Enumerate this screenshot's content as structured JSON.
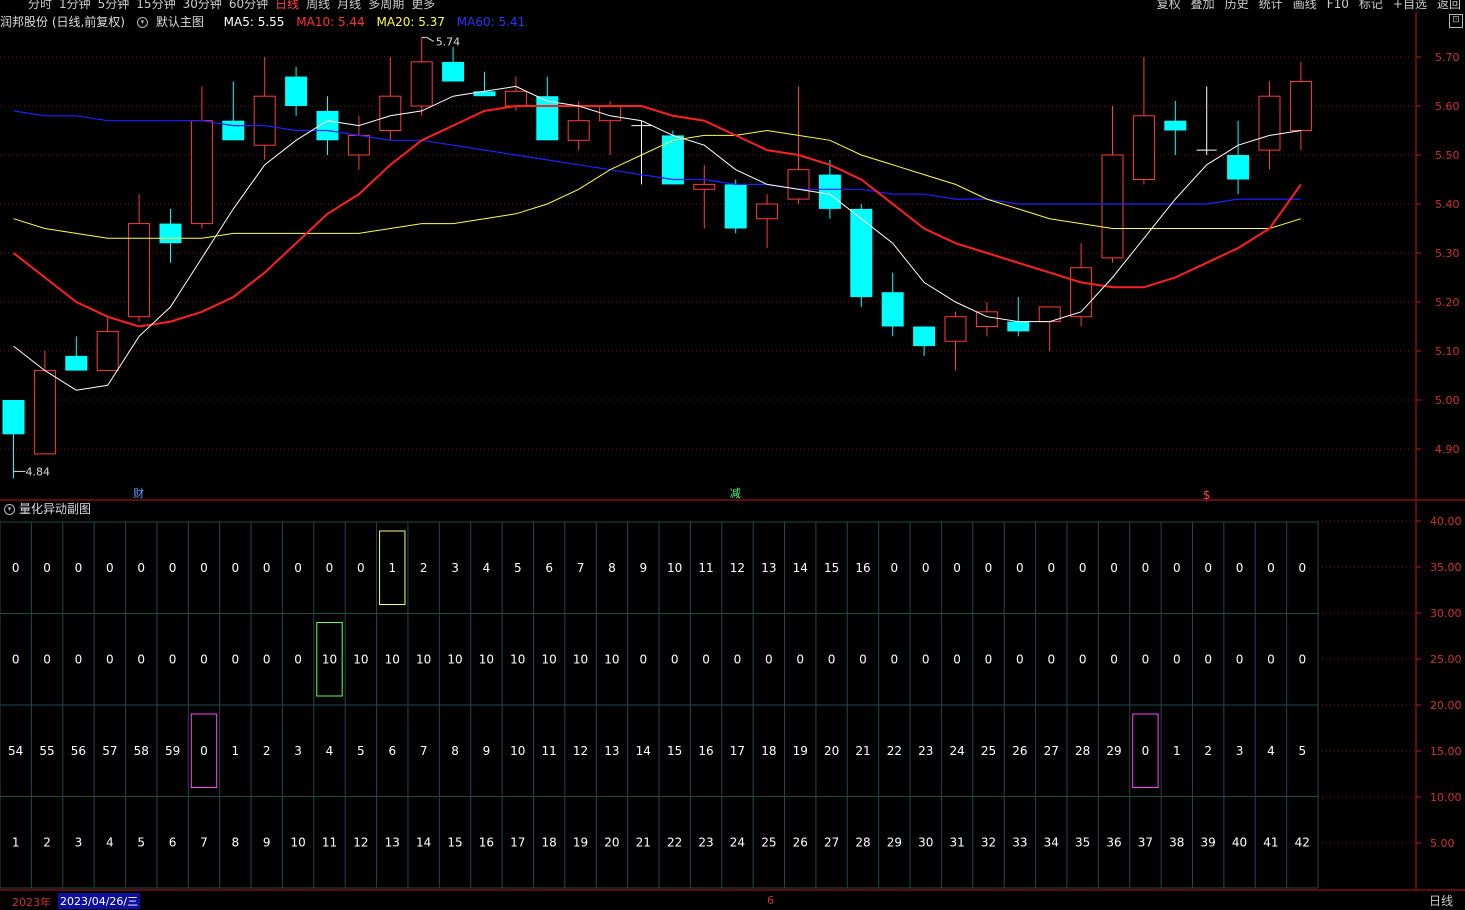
{
  "toolbar": {
    "periods": [
      "分时",
      "1分钟",
      "5分钟",
      "15分钟",
      "30分钟",
      "60分钟",
      "日线",
      "周线",
      "月线",
      "多周期",
      "更多"
    ],
    "active_period": "日线",
    "buttons": [
      "复权",
      "叠加",
      "历史",
      "统计",
      "画线",
      "F10",
      "标记",
      "+自选",
      "返回"
    ]
  },
  "info": {
    "stock": "润邦股份 (日线,前复权)",
    "template": "默认主图",
    "ma5": "MA5: 5.55",
    "ma10": "MA10: 5.44",
    "ma20": "MA20: 5.37",
    "ma60": "MA60: 5.41"
  },
  "colors": {
    "up": "#ff3b3b",
    "down": "#00ffff",
    "ma5": "#ffffff",
    "ma10": "#ff2020",
    "ma20": "#ffff40",
    "ma60": "#2020ff",
    "grid": "#7a1010",
    "axis": "#c01818",
    "panel_grid": "#1f4a4a"
  },
  "subchart": {
    "title": "量化异动副图"
  },
  "markers": {
    "cai": "财",
    "jian": "减",
    "dollar": "$"
  },
  "dates": {
    "year": "2023年",
    "cursor": "2023/04/26/三",
    "month_mark": "6"
  },
  "period_label": "日线",
  "chart_data": [
    {
      "type": "candlestick",
      "ylim": [
        4.82,
        5.75
      ],
      "y_ticks": [
        "5.70",
        "5.60",
        "5.50",
        "5.40",
        "5.30",
        "5.20",
        "5.10",
        "5.00",
        "4.90"
      ],
      "annotations": {
        "max": "5.74",
        "min": "4.84"
      },
      "ohlc": [
        [
          5.0,
          5.0,
          4.84,
          4.93
        ],
        [
          4.89,
          5.1,
          4.89,
          5.06
        ],
        [
          5.09,
          5.13,
          5.06,
          5.06
        ],
        [
          5.06,
          5.17,
          5.06,
          5.14
        ],
        [
          5.17,
          5.42,
          5.16,
          5.36
        ],
        [
          5.36,
          5.39,
          5.28,
          5.32
        ],
        [
          5.36,
          5.64,
          5.35,
          5.57
        ],
        [
          5.57,
          5.65,
          5.53,
          5.53
        ],
        [
          5.52,
          5.7,
          5.49,
          5.62
        ],
        [
          5.66,
          5.68,
          5.58,
          5.6
        ],
        [
          5.59,
          5.62,
          5.5,
          5.53
        ],
        [
          5.5,
          5.58,
          5.47,
          5.54
        ],
        [
          5.55,
          5.7,
          5.53,
          5.62
        ],
        [
          5.6,
          5.74,
          5.58,
          5.69
        ],
        [
          5.69,
          5.72,
          5.65,
          5.65
        ],
        [
          5.63,
          5.67,
          5.62,
          5.62
        ],
        [
          5.6,
          5.66,
          5.59,
          5.63
        ],
        [
          5.62,
          5.66,
          5.53,
          5.53
        ],
        [
          5.53,
          5.61,
          5.51,
          5.57
        ],
        [
          5.57,
          5.61,
          5.5,
          5.6
        ],
        [
          5.56,
          5.57,
          5.44,
          5.56
        ],
        [
          5.54,
          5.55,
          5.44,
          5.44
        ],
        [
          5.43,
          5.48,
          5.35,
          5.44
        ],
        [
          5.44,
          5.45,
          5.34,
          5.35
        ],
        [
          5.37,
          5.42,
          5.31,
          5.4
        ],
        [
          5.41,
          5.64,
          5.4,
          5.47
        ],
        [
          5.46,
          5.49,
          5.37,
          5.39
        ],
        [
          5.39,
          5.4,
          5.19,
          5.21
        ],
        [
          5.22,
          5.26,
          5.13,
          5.15
        ],
        [
          5.15,
          5.15,
          5.09,
          5.11
        ],
        [
          5.12,
          5.18,
          5.06,
          5.17
        ],
        [
          5.15,
          5.2,
          5.13,
          5.18
        ],
        [
          5.16,
          5.21,
          5.13,
          5.14
        ],
        [
          5.16,
          5.19,
          5.1,
          5.19
        ],
        [
          5.17,
          5.32,
          5.15,
          5.27
        ],
        [
          5.29,
          5.6,
          5.28,
          5.5
        ],
        [
          5.45,
          5.7,
          5.44,
          5.58
        ],
        [
          5.57,
          5.61,
          5.5,
          5.55
        ],
        [
          5.51,
          5.64,
          5.5,
          5.51
        ],
        [
          5.5,
          5.57,
          5.42,
          5.45
        ],
        [
          5.51,
          5.65,
          5.47,
          5.62
        ],
        [
          5.55,
          5.69,
          5.51,
          5.65
        ]
      ],
      "ma5": [
        5.11,
        5.06,
        5.02,
        5.03,
        5.13,
        5.19,
        5.29,
        5.39,
        5.48,
        5.53,
        5.57,
        5.56,
        5.58,
        5.59,
        5.62,
        5.63,
        5.64,
        5.61,
        5.6,
        5.58,
        5.57,
        5.54,
        5.52,
        5.47,
        5.44,
        5.43,
        5.42,
        5.37,
        5.32,
        5.24,
        5.2,
        5.17,
        5.16,
        5.16,
        5.18,
        5.25,
        5.33,
        5.41,
        5.48,
        5.52,
        5.54,
        5.55
      ],
      "ma10": [
        5.3,
        5.25,
        5.2,
        5.17,
        5.15,
        5.16,
        5.18,
        5.21,
        5.26,
        5.32,
        5.38,
        5.42,
        5.48,
        5.53,
        5.56,
        5.59,
        5.6,
        5.6,
        5.6,
        5.6,
        5.6,
        5.58,
        5.57,
        5.54,
        5.51,
        5.5,
        5.48,
        5.45,
        5.4,
        5.35,
        5.32,
        5.3,
        5.28,
        5.26,
        5.24,
        5.23,
        5.23,
        5.25,
        5.28,
        5.31,
        5.35,
        5.44
      ],
      "ma20": [
        5.37,
        5.35,
        5.34,
        5.33,
        5.33,
        5.33,
        5.33,
        5.34,
        5.34,
        5.34,
        5.34,
        5.34,
        5.35,
        5.36,
        5.36,
        5.37,
        5.38,
        5.4,
        5.43,
        5.47,
        5.5,
        5.53,
        5.54,
        5.54,
        5.55,
        5.54,
        5.53,
        5.5,
        5.48,
        5.46,
        5.44,
        5.41,
        5.39,
        5.37,
        5.36,
        5.35,
        5.35,
        5.35,
        5.35,
        5.35,
        5.35,
        5.37
      ],
      "ma60": [
        5.59,
        5.58,
        5.58,
        5.57,
        5.57,
        5.57,
        5.57,
        5.56,
        5.56,
        5.55,
        5.55,
        5.54,
        5.53,
        5.53,
        5.52,
        5.51,
        5.5,
        5.49,
        5.48,
        5.47,
        5.46,
        5.45,
        5.45,
        5.44,
        5.44,
        5.43,
        5.43,
        5.43,
        5.42,
        5.42,
        5.41,
        5.41,
        5.4,
        5.4,
        5.4,
        5.4,
        5.4,
        5.4,
        5.4,
        5.41,
        5.41,
        5.41
      ]
    },
    {
      "type": "table",
      "y_ticks": [
        "40.00",
        "35.00",
        "30.00",
        "25.00",
        "20.00",
        "15.00",
        "10.00",
        "5.00"
      ],
      "rows": [
        [
          0,
          0,
          0,
          0,
          0,
          0,
          0,
          0,
          0,
          0,
          0,
          0,
          1,
          2,
          3,
          4,
          5,
          6,
          7,
          8,
          9,
          10,
          11,
          12,
          13,
          14,
          15,
          16,
          0,
          0,
          0,
          0,
          0,
          0,
          0,
          0,
          0,
          0,
          0,
          0,
          0,
          0
        ],
        [
          0,
          0,
          0,
          0,
          0,
          0,
          0,
          0,
          0,
          0,
          10,
          10,
          10,
          10,
          10,
          10,
          10,
          10,
          10,
          10,
          0,
          0,
          0,
          0,
          0,
          0,
          0,
          0,
          0,
          0,
          0,
          0,
          0,
          0,
          0,
          0,
          0,
          0,
          0,
          0,
          0,
          0
        ],
        [
          54,
          55,
          56,
          57,
          58,
          59,
          0,
          1,
          2,
          3,
          4,
          5,
          6,
          7,
          8,
          9,
          10,
          11,
          12,
          13,
          14,
          15,
          16,
          17,
          18,
          19,
          20,
          21,
          22,
          23,
          24,
          25,
          26,
          27,
          28,
          29,
          0,
          1,
          2,
          3,
          4,
          5
        ],
        [
          1,
          2,
          3,
          4,
          5,
          6,
          7,
          8,
          9,
          10,
          11,
          12,
          13,
          14,
          15,
          16,
          17,
          18,
          19,
          20,
          21,
          22,
          23,
          24,
          25,
          26,
          27,
          28,
          29,
          30,
          31,
          32,
          33,
          34,
          35,
          36,
          37,
          38,
          39,
          40,
          41,
          42
        ]
      ],
      "highlights": [
        {
          "row": 0,
          "col": 12,
          "color": "#ffff66"
        },
        {
          "row": 1,
          "col": 10,
          "color": "#66ff66"
        },
        {
          "row": 2,
          "col": 6,
          "color": "#ff44ff"
        },
        {
          "row": 2,
          "col": 36,
          "color": "#ff44ff"
        }
      ]
    }
  ]
}
